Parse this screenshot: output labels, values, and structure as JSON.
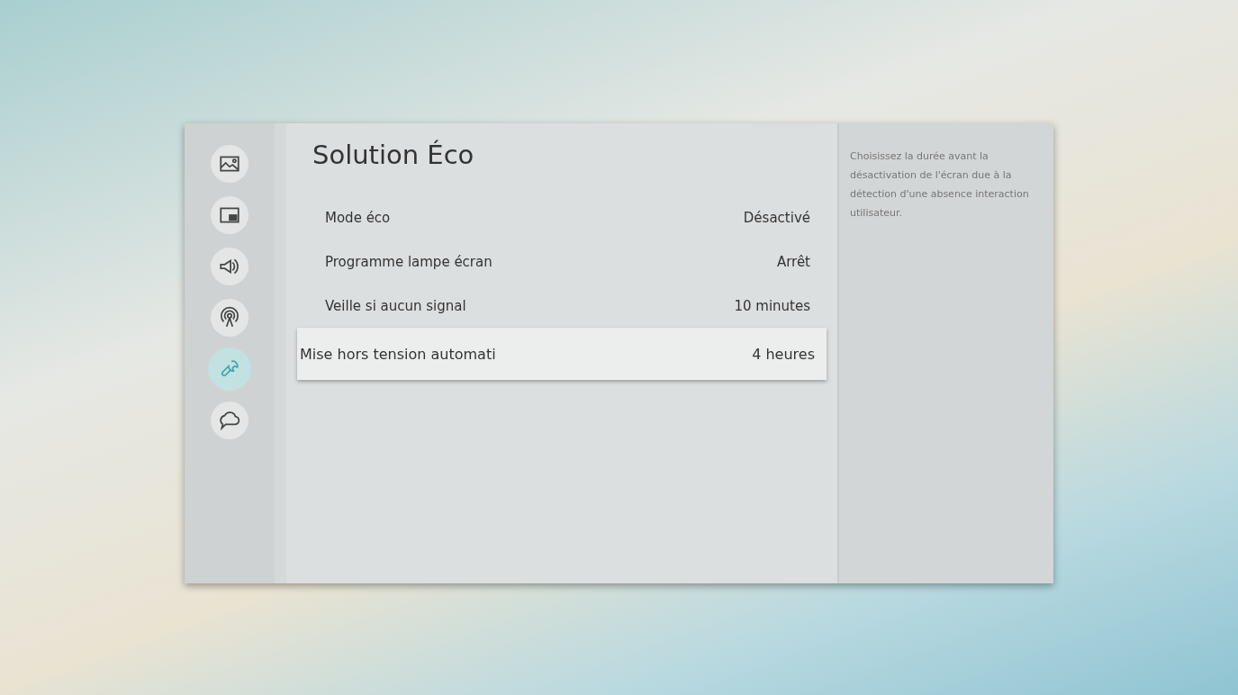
{
  "sidebar": {
    "items": [
      {
        "kind": "picture",
        "selected": false
      },
      {
        "kind": "pip",
        "selected": false
      },
      {
        "kind": "sound",
        "selected": false
      },
      {
        "kind": "broadcast",
        "selected": false
      },
      {
        "kind": "tools",
        "selected": true
      },
      {
        "kind": "support",
        "selected": false
      }
    ]
  },
  "title": "Solution Éco",
  "settings": [
    {
      "label": "Mode éco",
      "value": "Désactivé",
      "selected": false
    },
    {
      "label": "Programme lampe écran",
      "value": "Arrêt",
      "selected": false
    },
    {
      "label": "Veille si aucun signal",
      "value": "10 minutes",
      "selected": false
    },
    {
      "label": "Mise hors tension automati",
      "value": "4 heures",
      "selected": true
    }
  ],
  "help_text": "Choisissez la durée avant la désactivation de l'écran due à la détection d'une absence interaction utilisateur."
}
